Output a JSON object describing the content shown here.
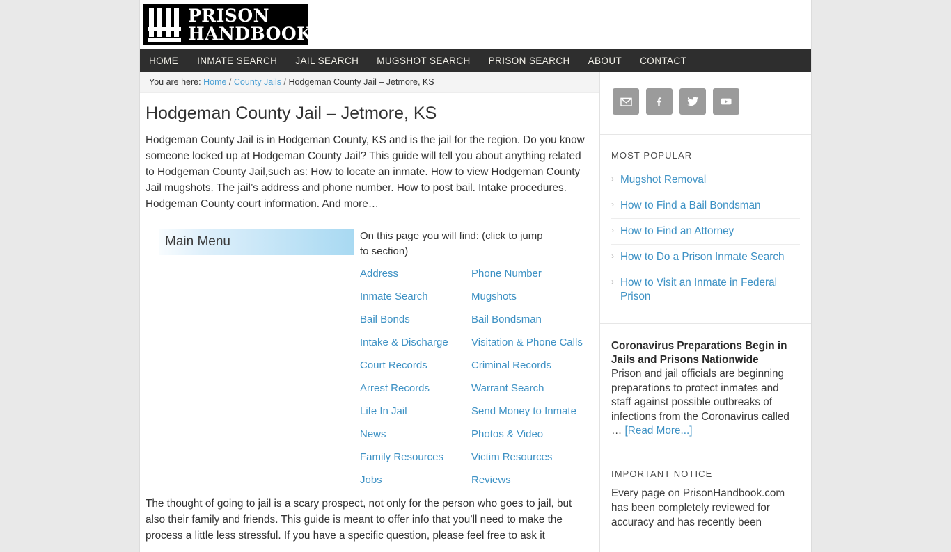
{
  "site": {
    "logo_line1": "PRISON",
    "logo_line2": "HANDBOOK",
    "logo_icon": "prison-bars-icon"
  },
  "nav": {
    "items": [
      {
        "label": "HOME"
      },
      {
        "label": "INMATE SEARCH"
      },
      {
        "label": "JAIL SEARCH"
      },
      {
        "label": "MUGSHOT SEARCH"
      },
      {
        "label": "PRISON SEARCH"
      },
      {
        "label": "ABOUT"
      },
      {
        "label": "CONTACT"
      }
    ]
  },
  "breadcrumb": {
    "prefix": "You are here:",
    "home": "Home",
    "sep1": "/",
    "category": "County Jails",
    "sep2": "/",
    "current": "Hodgeman County Jail – Jetmore, KS"
  },
  "main": {
    "title": "Hodgeman County Jail – Jetmore, KS",
    "intro": "Hodgeman County Jail is in Hodgeman County, KS and is the jail for the region. Do you know someone locked up at Hodgeman County Jail? This guide will tell you about anything related to Hodgeman County Jail,such as: How to locate an inmate. How to view Hodgeman County Jail mugshots. The jail’s address and phone number. How to post bail. Intake procedures. Hodgeman County court information. And more…",
    "menu_box_title": "Main Menu",
    "jump_intro": "On this page you will find: (click to jump to section)",
    "jump_links": [
      {
        "left": "Address",
        "right": "Phone Number"
      },
      {
        "left": "Inmate Search",
        "right": "Mugshots"
      },
      {
        "left": "Bail Bonds",
        "right": "Bail Bondsman"
      },
      {
        "left": "Intake & Discharge",
        "right": "Visitation & Phone Calls"
      },
      {
        "left": "Court Records",
        "right": "Criminal Records"
      },
      {
        "left": "Arrest Records",
        "right": "Warrant Search"
      },
      {
        "left": "Life In Jail",
        "right": "Send Money to Inmate"
      },
      {
        "left": "News",
        "right": "Photos & Video"
      },
      {
        "left": "Family Resources",
        "right": "Victim Resources"
      },
      {
        "left": "Jobs",
        "right": "Reviews"
      }
    ],
    "closing": "The thought of going to jail is a scary prospect, not only for the person who goes to jail, but also their family and friends. This guide is meant to offer info that you’ll need to make the process a little less stressful. If you have a specific question, please feel free to ask it"
  },
  "sidebar": {
    "social": [
      {
        "name": "email-icon",
        "label": "Email"
      },
      {
        "name": "facebook-icon",
        "label": "Facebook"
      },
      {
        "name": "twitter-icon",
        "label": "Twitter"
      },
      {
        "name": "youtube-icon",
        "label": "YouTube"
      }
    ],
    "popular": {
      "title": "MOST POPULAR",
      "items": [
        {
          "label": "Mugshot Removal"
        },
        {
          "label": "How to Find a Bail Bondsman"
        },
        {
          "label": "How to Find an Attorney"
        },
        {
          "label": "How to Do a Prison Inmate Search"
        },
        {
          "label": "How to Visit an Inmate in Federal Prison"
        }
      ]
    },
    "news": {
      "title": "Coronavirus Preparations Begin in Jails and Prisons Nationwide",
      "excerpt": "Prison and jail officials are beginning preparations to protect inmates and staff against possible outbreaks of infections from the Coronavirus called … ",
      "read_more": "[Read More...]"
    },
    "notice": {
      "title": "IMPORTANT NOTICE",
      "body": "Every page on PrisonHandbook.com has been completely reviewed for accuracy and has recently been"
    }
  },
  "colors": {
    "nav_bg": "#2e2e2e",
    "link_blue": "#3d91c4",
    "breadcrumb_bg": "#f4f4f4",
    "social_btn": "#9b9b9b",
    "menu_gradient_end": "#a8d9f2"
  }
}
